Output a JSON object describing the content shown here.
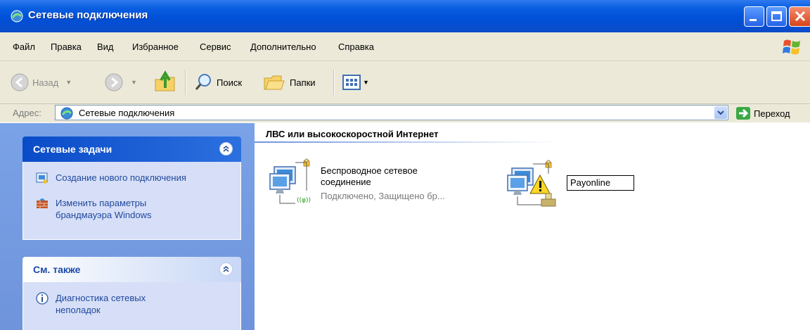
{
  "window": {
    "title": "Сетевые подключения"
  },
  "menu": {
    "items": [
      "Файл",
      "Правка",
      "Вид",
      "Избранное",
      "Сервис",
      "Дополнительно",
      "Справка"
    ]
  },
  "toolbar": {
    "back_label": "Назад",
    "search_label": "Поиск",
    "folders_label": "Папки"
  },
  "address": {
    "label": "Адрес:",
    "value": "Сетевые подключения",
    "go_label": "Переход"
  },
  "network_tasks": {
    "title": "Сетевые задачи",
    "items": [
      {
        "label": "Создание нового подключения",
        "icon": "new-connection-icon"
      },
      {
        "label": "Изменить параметры брандмауэра Windows",
        "icon": "firewall-icon"
      }
    ]
  },
  "see_also": {
    "title": "См. также",
    "items": [
      {
        "label": "Диагностика сетевых неполадок",
        "icon": "info-icon"
      }
    ]
  },
  "content": {
    "group_title": "ЛВС или высокоскоростной Интернет",
    "connections": [
      {
        "name": "Беспроводное сетевое соединение",
        "status": "Подключено, Защищено бр..."
      },
      {
        "name": "Payonline",
        "status": ""
      }
    ]
  },
  "colors": {
    "titlebar": "#0050d8",
    "taskpane": "#7aa2e6",
    "link": "#21489d"
  }
}
